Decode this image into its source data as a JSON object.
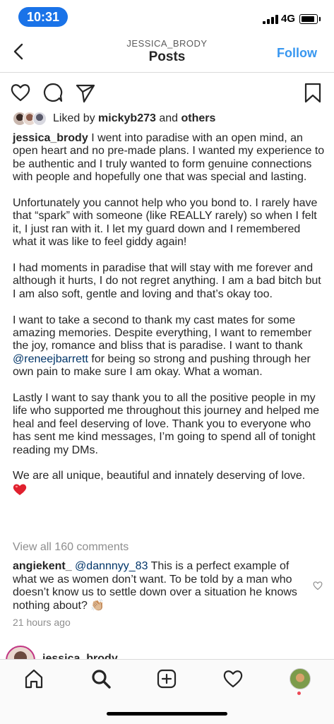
{
  "status_bar": {
    "time": "10:31",
    "network": "4G",
    "accent_color": "#1a73e8"
  },
  "header": {
    "username": "JESSICA_BRODY",
    "title": "Posts",
    "follow_label": "Follow",
    "follow_color": "#3897f0"
  },
  "post": {
    "likes": {
      "prefix": "Liked by",
      "user": "mickyb273",
      "conjunction": "and",
      "others": "others"
    },
    "caption": {
      "username": "jessica_brody",
      "p1": "I went into paradise with an open mind, an open heart and no pre-made plans. I wanted my experience to be authentic and I truly wanted to form genuine connections with people and hopefully one that was special and lasting.",
      "p2": "Unfortunately you cannot help who you bond to. I rarely have that “spark” with someone (like REALLY rarely) so when I felt it, I just ran with it. I let my guard down and I remembered what it was like to feel giddy again!",
      "p3": "I had moments in paradise that will stay with me forever and although it hurts, I do not regret anything. I am a bad bitch but I am also soft, gentle and loving and that’s okay too.",
      "p4_before": "I want to take a second to thank my cast mates for some amazing memories. Despite everything, I want to remember the joy, romance and bliss that is paradise. I want to thank",
      "p4_mention": "@reneejbarrett",
      "p4_after": "for being so strong and pushing through her own pain to make sure I am okay. What a woman.",
      "p5": "Lastly I want to say thank you to all the positive people in my life who supported me throughout this journey and helped me heal and feel deserving of love. Thank you to everyone who has sent me kind messages, I’m going to spend all of tonight reading my DMs.",
      "p6": "We are all unique, beautiful and innately deserving of love."
    },
    "view_all_comments": "View all 160 comments",
    "top_comment": {
      "username": "angiekent_",
      "mention": "@dannnyy_83",
      "text": "This is a perfect example of what we as women don’t want. To be told by a man who doesn’t know us to settle down over a situation he knows nothing about?",
      "emoji": "👏🏼"
    },
    "time_ago": "21 hours ago"
  },
  "next_post": {
    "username": "jessica_brody"
  },
  "icons": {
    "back": "chevron-left-icon",
    "like": "heart-outline-icon",
    "comment": "comment-bubble-icon",
    "share": "paper-plane-icon",
    "save": "bookmark-icon",
    "home": "home-icon",
    "search": "search-icon",
    "new_post": "plus-square-icon",
    "activity": "heart-outline-icon",
    "profile": "profile-avatar"
  }
}
